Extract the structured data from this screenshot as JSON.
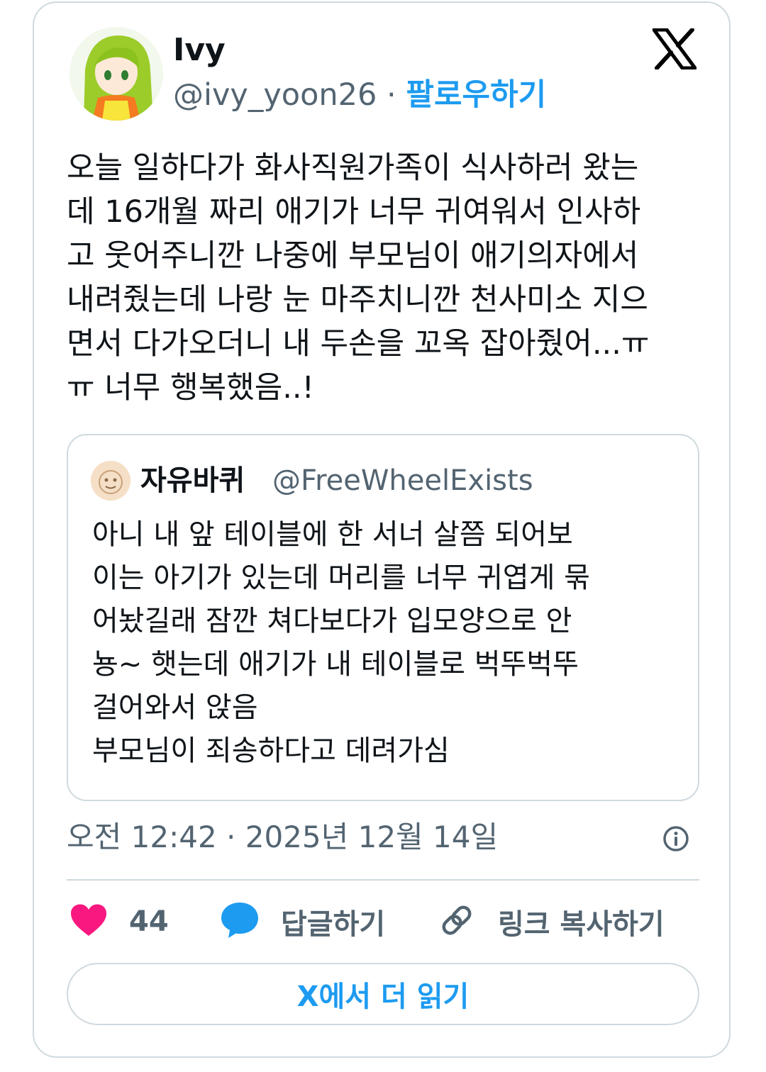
{
  "tweet": {
    "author_name": "Ivy",
    "author_handle": "@ivy_yoon26",
    "separator": "·",
    "follow_label": "팔로우하기",
    "text": "오늘 일하다가 화사직원가족이 식사하러 왔는\n데 16개월 짜리 애기가 너무 귀여워서 인사하\n고 웃어주니깐 나중에 부모님이 애기의자에서\n내려줬는데 나랑 눈 마주치니깐 천사미소 지으\n면서 다가오더니 내 두손을 꼬옥 잡아줬어...ㅠ\nㅠ 너무 행복했음..!",
    "timestamp": "오전 12:42 · 2025년 12월 14일"
  },
  "quoted_tweet": {
    "author_name": "자유바퀴",
    "author_handle": "@FreeWheelExists",
    "text": "아니 내 앞 테이블에 한 서너 살쯤 되어보\n이는 아기가 있는데 머리를 너무 귀엽게 묶\n어놨길래 잠깐 쳐다보다가 입모양으로 안\n뇽~ 햇는데 애기가 내 테이블로 벅뚜벅뚜\n걸어와서 앉음\n부모님이 죄송하다고 데려가심"
  },
  "actions": {
    "like_count": "44",
    "reply_label": "답글하기",
    "copy_link_label": "링크 복사하기"
  },
  "read_more_label": "X에서 더 읽기",
  "icons": {
    "brand": "x-logo-icon",
    "like": "heart-icon",
    "reply": "speech-bubble-icon",
    "copy": "link-icon",
    "info": "info-icon"
  },
  "colors": {
    "accent": "#1d9bf0",
    "like": "#f91880",
    "secondary_text": "#536471",
    "border": "#cfd9de"
  }
}
